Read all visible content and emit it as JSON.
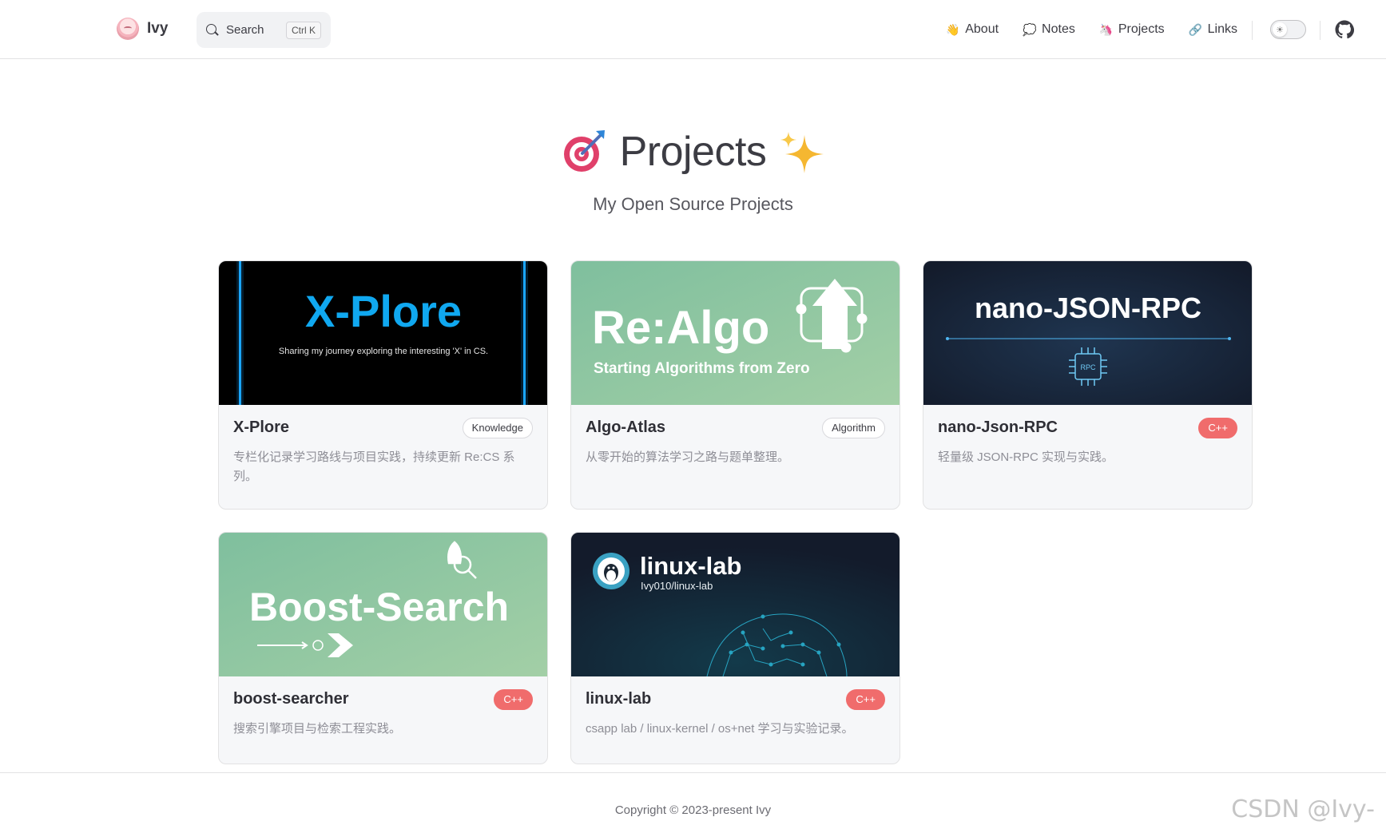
{
  "nav": {
    "brand": "Ivy",
    "search_label": "Search",
    "search_shortcut": "Ctrl K",
    "links": [
      {
        "emoji": "👋",
        "label": "About"
      },
      {
        "emoji": "💭",
        "label": "Notes"
      },
      {
        "emoji": "🦄",
        "label": "Projects"
      },
      {
        "emoji": "🔗",
        "label": "Links"
      }
    ],
    "theme_icon": "sun-icon",
    "github_icon": "github-icon"
  },
  "hero": {
    "emoji_left": "🎯",
    "title": "Projects",
    "emoji_right": "✨",
    "subtitle": "My Open Source Projects"
  },
  "projects": [
    {
      "name": "X-Plore",
      "tag": "Knowledge",
      "description": "专栏化记录学习路线与项目实践，持续更新 Re:CS 系列。",
      "banner": {
        "title": "X-Plore",
        "subtitle": "Sharing my journey exploring the interesting 'X' in CS."
      }
    },
    {
      "name": "Algo-Atlas",
      "tag": "Algorithm",
      "description": "从零开始的算法学习之路与题单整理。",
      "banner": {
        "title": "Re:Algo",
        "subtitle": "Starting Algorithms from Zero"
      }
    },
    {
      "name": "nano-Json-RPC",
      "tag": "C++",
      "description": "轻量级 JSON-RPC 实现与实践。",
      "banner": {
        "title": "nano-JSON-RPC",
        "chip_label": "RPC"
      }
    },
    {
      "name": "boost-searcher",
      "tag": "C++",
      "description": "搜索引擎项目与检索工程实践。",
      "banner": {
        "title": "Boost-Search"
      }
    },
    {
      "name": "linux-lab",
      "tag": "C++",
      "description": "csapp lab / linux-kernel / os+net 学习与实验记录。",
      "banner": {
        "title": "linux-lab",
        "subtitle": "Ivy010/linux-lab"
      }
    }
  ],
  "footer": {
    "copyright": "Copyright © 2023-present Ivy"
  },
  "watermark": "CSDN @Ivy-"
}
